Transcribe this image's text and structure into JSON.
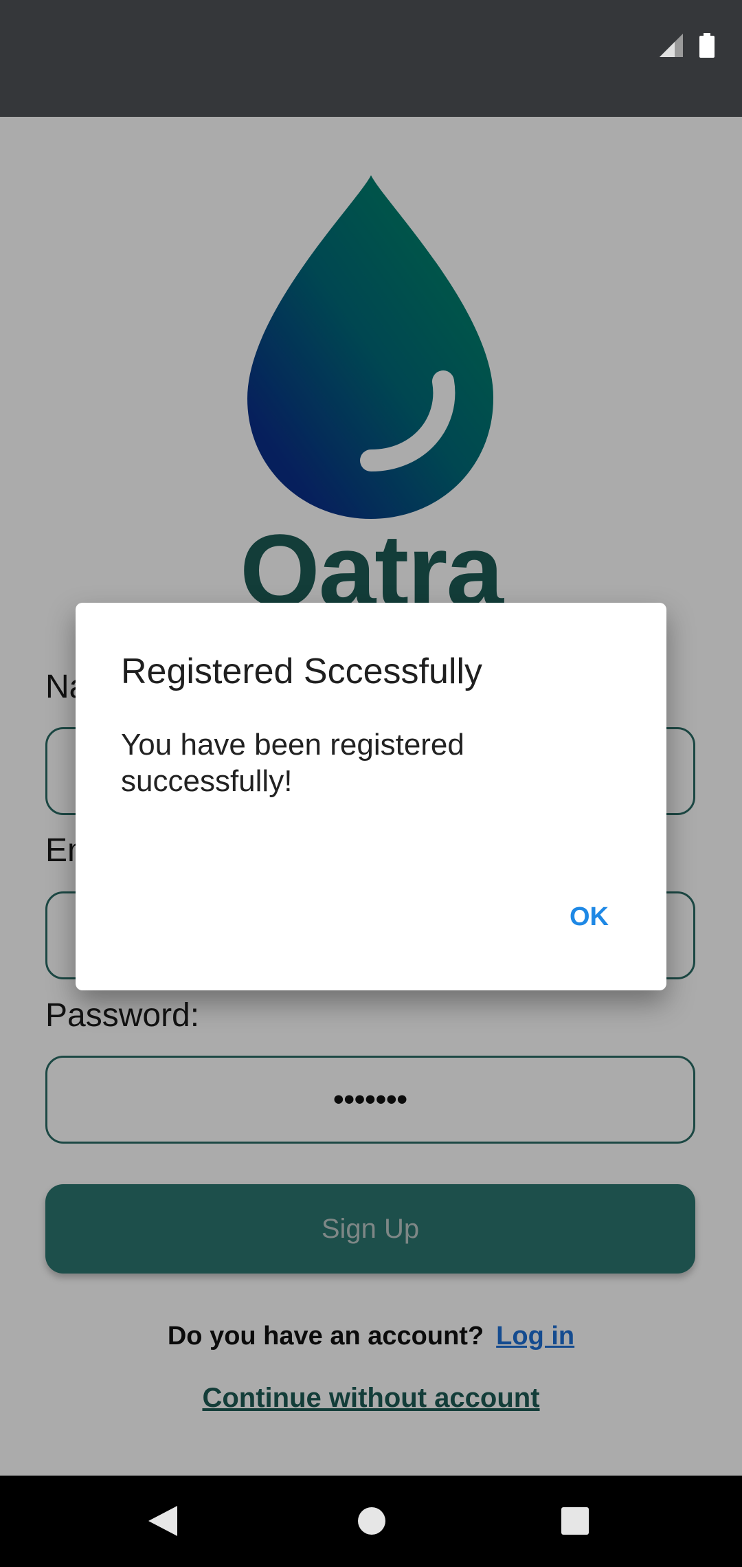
{
  "app": {
    "brand_name": "Qatra"
  },
  "form": {
    "name_label": "Name:",
    "email_label": "Email:",
    "password_label": "Password:",
    "password_value": "•••••••",
    "signup_label": "Sign Up",
    "account_question": "Do you have an account?",
    "login_link": "Log in",
    "continue_link": "Continue without account"
  },
  "dialog": {
    "title": "Registered Sccessfully",
    "message": "You have been registered successfully!",
    "ok_label": "OK"
  },
  "colors": {
    "brand": "#1d5b56",
    "button": "#2c7670",
    "link": "#1e70d6",
    "dialog_action": "#1e88e5"
  }
}
